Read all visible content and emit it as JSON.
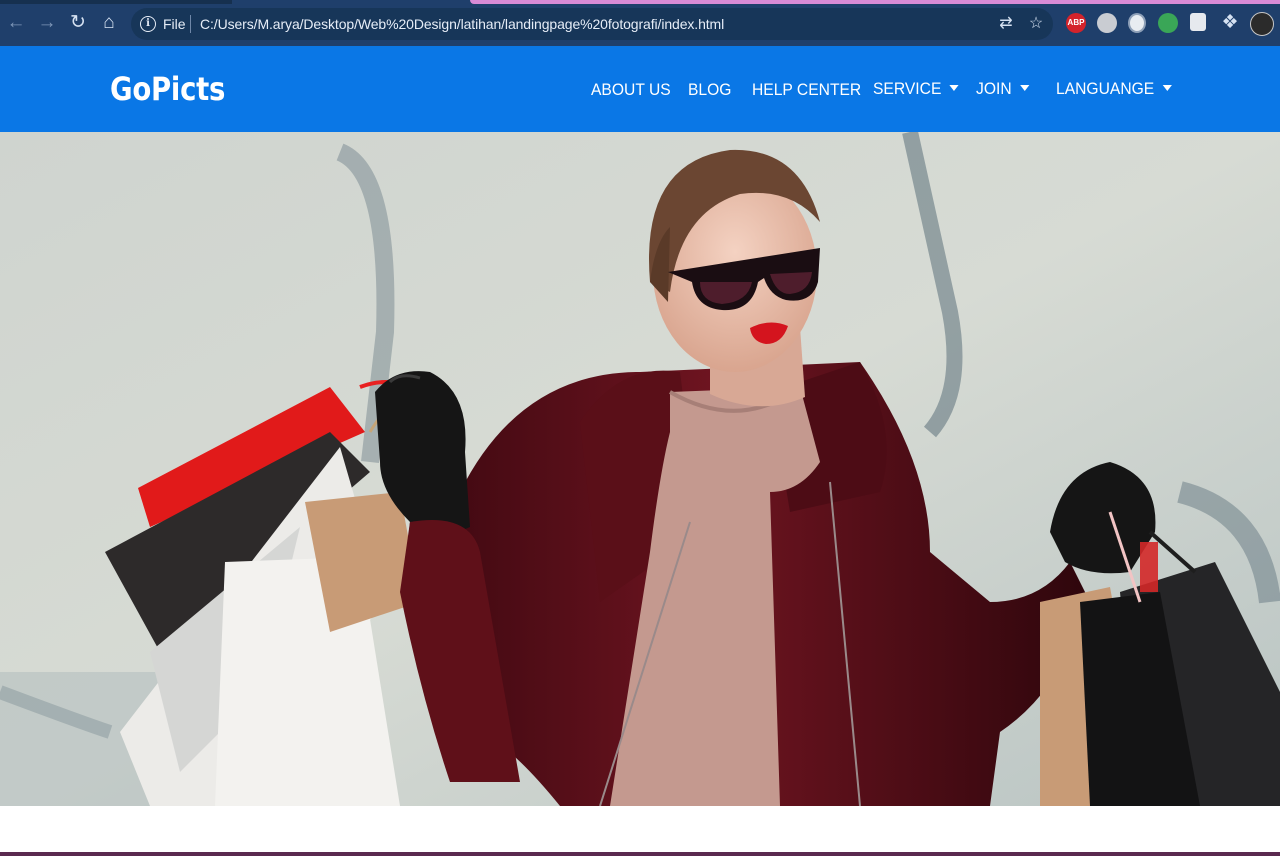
{
  "browser": {
    "site_info_label": "File",
    "url": "C:/Users/M.arya/Desktop/Web%20Design/latihan/landingpage%20fotografi/index.html",
    "icons": [
      "back-icon",
      "forward-icon",
      "reload-icon",
      "home-icon",
      "info-icon",
      "translate-icon",
      "star-icon",
      "abp-extension-icon",
      "extension-icon",
      "extension-icon",
      "extension-icon",
      "extension-icon",
      "puzzle-icon",
      "profile-avatar"
    ],
    "abp_label": "ABP"
  },
  "site": {
    "brand": "GoPicts",
    "nav": {
      "about": "ABOUT US",
      "blog": "BLOG",
      "help": "HELP CENTER",
      "service": "SERVICE",
      "join": "JOIN",
      "language": "LANGUANGE"
    },
    "colors": {
      "navbar": "#0a77e6",
      "chrome": "#1f3f6b"
    }
  }
}
